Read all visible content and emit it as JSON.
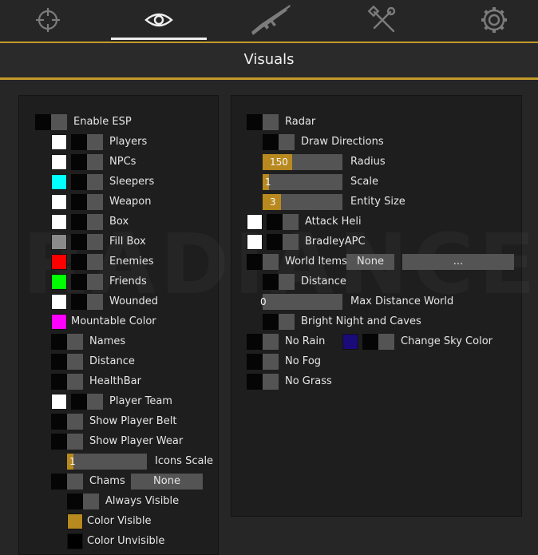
{
  "title": "Visuals",
  "tabs": [
    {
      "icon": "crosshair-icon",
      "active": false
    },
    {
      "icon": "eye-icon",
      "active": true
    },
    {
      "icon": "rifle-icon",
      "active": false
    },
    {
      "icon": "tools-icon",
      "active": false
    },
    {
      "icon": "gear-icon",
      "active": false
    }
  ],
  "watermark": "RADIANCE",
  "colors": {
    "accent": "#c49a2a",
    "slider_fill": "#b8891e",
    "toggle_off_track": "#545454",
    "toggle_knob": "#050505",
    "sleepers": "#00ffff",
    "enemies": "#ff0000",
    "friends": "#00ff00",
    "mountable": "#ff00ff",
    "color_visible": "#b8891e",
    "color_unvisible": "#000000",
    "sky": "#1a0a7a",
    "white": "#ffffff",
    "gray": "#8a8a8a"
  },
  "left": {
    "enable_esp": "Enable ESP",
    "players": "Players",
    "npcs": "NPCs",
    "sleepers": "Sleepers",
    "weapon": "Weapon",
    "box": "Box",
    "fill_box": "Fill Box",
    "enemies": "Enemies",
    "friends": "Friends",
    "wounded": "Wounded",
    "mountable_color": "Mountable Color",
    "names": "Names",
    "distance": "Distance",
    "healthbar": "HealthBar",
    "player_team": "Player Team",
    "show_player_belt": "Show Player Belt",
    "show_player_wear": "Show Player Wear",
    "icons_scale": "Icons Scale",
    "icons_scale_value": "1",
    "chams": "Chams",
    "chams_value": "None",
    "always_visible": "Always Visible",
    "color_visible": "Color Visible",
    "color_unvisible": "Color Unvisible"
  },
  "right": {
    "radar": "Radar",
    "draw_directions": "Draw Directions",
    "radius": "Radius",
    "radius_value": "150",
    "scale": "Scale",
    "scale_value": "1",
    "entity_size": "Entity Size",
    "entity_size_value": "3",
    "attack_heli": "Attack Heli",
    "bradley_apc": "BradleyAPC",
    "world_items": "World Items",
    "world_items_value": "None",
    "world_items_more": "...",
    "distance": "Distance",
    "max_distance_world": "Max Distance World",
    "max_distance_value": "0",
    "bright_night": "Bright Night and Caves",
    "no_rain": "No Rain",
    "change_sky_color": "Change Sky Color",
    "no_fog": "No Fog",
    "no_grass": "No Grass"
  },
  "sliders": {
    "icons_scale_fill": 0.08,
    "radius_fill": 0.38,
    "scale_fill": 0.08,
    "entity_size_fill": 0.23,
    "max_distance_fill": 0.0
  }
}
